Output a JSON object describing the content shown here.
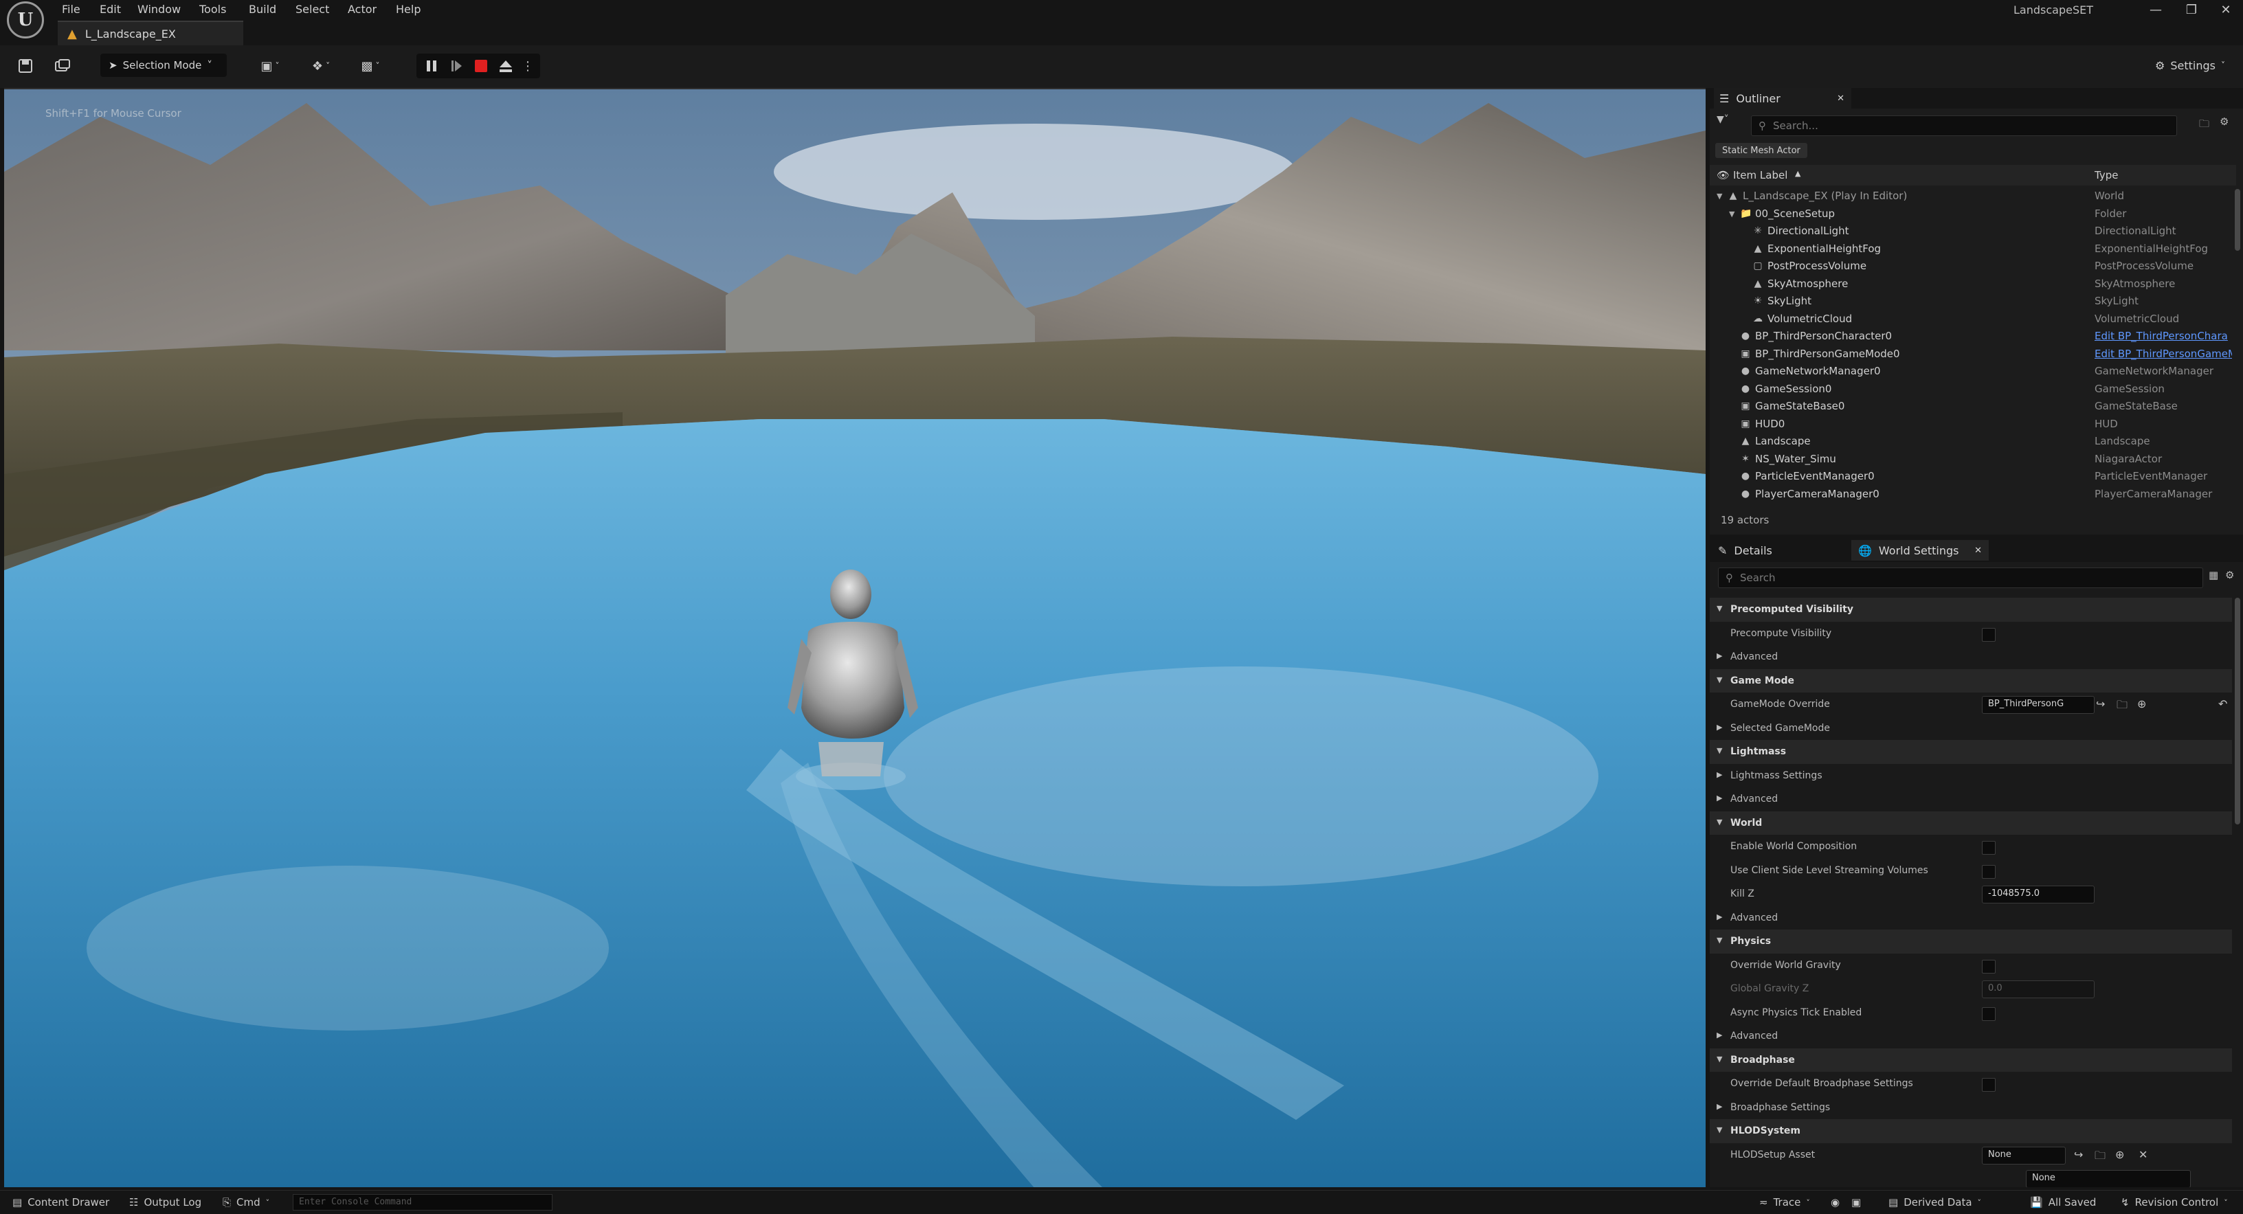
{
  "menu": [
    "File",
    "Edit",
    "Window",
    "Tools",
    "Build",
    "Select",
    "Actor",
    "Help"
  ],
  "project_name": "LandscapeSET",
  "level_tab": "L_Landscape_EX",
  "toolbar": {
    "selection_mode": "Selection Mode",
    "settings": "Settings"
  },
  "viewport": {
    "hint": "Shift+F1 for Mouse Cursor"
  },
  "outliner": {
    "title": "Outliner",
    "search_placeholder": "Search...",
    "filter_chip": "Static Mesh Actor",
    "col_label": "Item Label",
    "col_type": "Type",
    "rows": [
      {
        "label": "L_Landscape_EX (Play In Editor)",
        "type": "World",
        "icon": "world-icon"
      },
      {
        "label": "00_SceneSetup",
        "type": "Folder",
        "icon": "folder-icon"
      },
      {
        "label": "DirectionalLight",
        "type": "DirectionalLight",
        "icon": "light-icon"
      },
      {
        "label": "ExponentialHeightFog",
        "type": "ExponentialHeightFog",
        "icon": "fog-icon"
      },
      {
        "label": "PostProcessVolume",
        "type": "PostProcessVolume",
        "icon": "volume-icon"
      },
      {
        "label": "SkyAtmosphere",
        "type": "SkyAtmosphere",
        "icon": "atmosphere-icon"
      },
      {
        "label": "SkyLight",
        "type": "SkyLight",
        "icon": "skylight-icon"
      },
      {
        "label": "VolumetricCloud",
        "type": "VolumetricCloud",
        "icon": "cloud-icon"
      },
      {
        "label": "BP_ThirdPersonCharacter0",
        "type": "Edit BP_ThirdPersonChara",
        "icon": "pawn-icon"
      },
      {
        "label": "BP_ThirdPersonGameMode0",
        "type": "Edit BP_ThirdPersonGameM",
        "icon": "gamemode-icon"
      },
      {
        "label": "GameNetworkManager0",
        "type": "GameNetworkManager",
        "icon": "actor-icon"
      },
      {
        "label": "GameSession0",
        "type": "GameSession",
        "icon": "actor-icon"
      },
      {
        "label": "GameStateBase0",
        "type": "GameStateBase",
        "icon": "gamestate-icon"
      },
      {
        "label": "HUD0",
        "type": "HUD",
        "icon": "hud-icon"
      },
      {
        "label": "Landscape",
        "type": "Landscape",
        "icon": "landscape-icon"
      },
      {
        "label": "NS_Water_Simu",
        "type": "NiagaraActor",
        "icon": "niagara-icon"
      },
      {
        "label": "ParticleEventManager0",
        "type": "ParticleEventManager",
        "icon": "actor-icon"
      },
      {
        "label": "PlayerCameraManager0",
        "type": "PlayerCameraManager",
        "icon": "actor-icon"
      }
    ],
    "actor_count": "19 actors"
  },
  "details": {
    "tab_details": "Details",
    "tab_world_settings": "World Settings",
    "search_placeholder": "Search",
    "rows": [
      {
        "label": "Precomputed Visibility"
      },
      {
        "label": "Precompute Visibility"
      },
      {
        "label": "Advanced"
      },
      {
        "label": "Game Mode"
      },
      {
        "label": "GameMode Override",
        "value": "BP_ThirdPersonG"
      },
      {
        "label": "Selected GameMode"
      },
      {
        "label": "Lightmass"
      },
      {
        "label": "Lightmass Settings"
      },
      {
        "label": "Advanced"
      },
      {
        "label": "World"
      },
      {
        "label": "Enable World Composition"
      },
      {
        "label": "Use Client Side Level Streaming Volumes"
      },
      {
        "label": "Kill Z",
        "value": "-1048575.0"
      },
      {
        "label": "Advanced"
      },
      {
        "label": "Physics"
      },
      {
        "label": "Override World Gravity"
      },
      {
        "label": "Global Gravity Z",
        "value": "0.0"
      },
      {
        "label": "Async Physics Tick Enabled"
      },
      {
        "label": "Advanced"
      },
      {
        "label": "Broadphase"
      },
      {
        "label": "Override Default Broadphase Settings"
      },
      {
        "label": "Broadphase Settings"
      },
      {
        "label": "HLODSystem"
      },
      {
        "label": "HLODSetup Asset",
        "value": "None"
      },
      {
        "label": "",
        "value": "None"
      }
    ]
  },
  "statusbar": {
    "content_drawer": "Content Drawer",
    "output_log": "Output Log",
    "cmd": "Cmd",
    "console_placeholder": "Enter Console Command",
    "trace": "Trace",
    "derived_data": "Derived Data",
    "all_saved": "All Saved",
    "revision_control": "Revision Control"
  },
  "colors": {
    "accent_link": "#5f98ff",
    "stop_red": "#e02020",
    "water": "#3f8fc4",
    "folder": "#d9a441"
  }
}
